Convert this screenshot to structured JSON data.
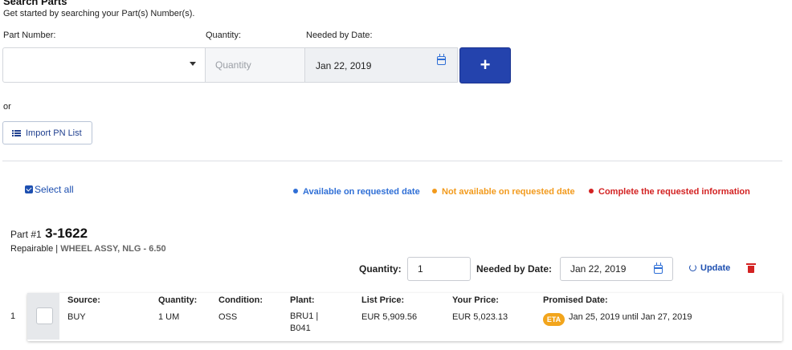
{
  "search": {
    "title": "Search Parts",
    "subtitle": "Get started by searching your Part(s) Number(s).",
    "part_number_label": "Part Number:",
    "quantity_label": "Quantity:",
    "needed_by_label": "Needed by Date:",
    "quantity_placeholder": "Quantity",
    "needed_by_value": "Jan 22, 2019",
    "add_button_label": "+",
    "or_text": "or",
    "import_button_label": "Import PN List"
  },
  "results": {
    "select_all_label": "Select all",
    "legend": [
      {
        "label": "Available on requested date",
        "color": "#2f6fd6"
      },
      {
        "label": "Not available on requested date",
        "color": "#f29a1c"
      },
      {
        "label": "Complete the requested information",
        "color": "#d32222"
      }
    ]
  },
  "part": {
    "prefix": "Part #1",
    "number": "3-1622",
    "type": "Repairable |",
    "description": "WHEEL ASSY, NLG - 6.50",
    "quantity_label": "Quantity:",
    "quantity_value": "1",
    "needed_by_label": "Needed by Date:",
    "needed_by_value": "Jan 22, 2019",
    "update_label": "Update"
  },
  "offer_row": {
    "index": "1",
    "columns": {
      "source": {
        "label": "Source:",
        "value": "BUY"
      },
      "quantity": {
        "label": "Quantity:",
        "value": "1 UM"
      },
      "condition": {
        "label": "Condition:",
        "value": "OSS"
      },
      "plant": {
        "label": "Plant:",
        "value": "BRU1 | B041"
      },
      "list_price": {
        "label": "List Price:",
        "value": "EUR 5,909.56"
      },
      "your_price": {
        "label": "Your Price:",
        "value": "EUR 5,023.13"
      },
      "promised_date": {
        "label": "Promised Date:",
        "badge": "ETA",
        "value": "Jan 25, 2019 until Jan 27, 2019"
      }
    }
  }
}
